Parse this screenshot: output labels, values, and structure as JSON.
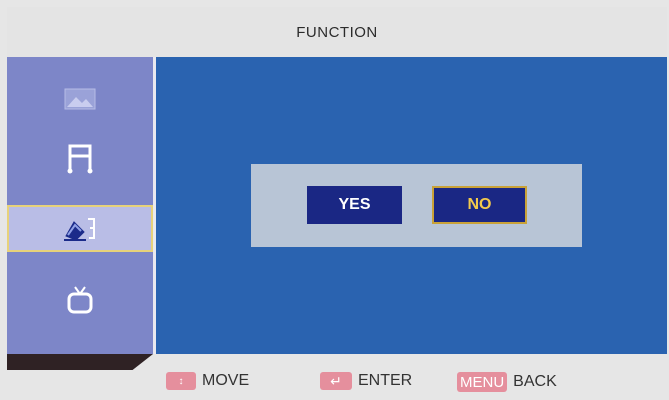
{
  "header": {
    "title": "FUNCTION"
  },
  "sidebar": {
    "items": [
      {
        "icon": "picture-icon",
        "selected": false
      },
      {
        "icon": "music-note-icon",
        "selected": false
      },
      {
        "icon": "function-settings-icon",
        "selected": true
      },
      {
        "icon": "tv-icon",
        "selected": false
      }
    ]
  },
  "dialog": {
    "yes_label": "YES",
    "no_label": "NO",
    "focused": "NO"
  },
  "footer": {
    "move_key": "↕",
    "move_label": "MOVE",
    "enter_key": "↵",
    "enter_label": "ENTER",
    "back_key": "MENU",
    "back_label": "BACK"
  },
  "colors": {
    "main_bg": "#2a63b0",
    "sidebar_bg": "#7d86c8",
    "button_bg": "#1a2784",
    "focus_text": "#f2c94c",
    "key_pink": "#e58f9d"
  }
}
